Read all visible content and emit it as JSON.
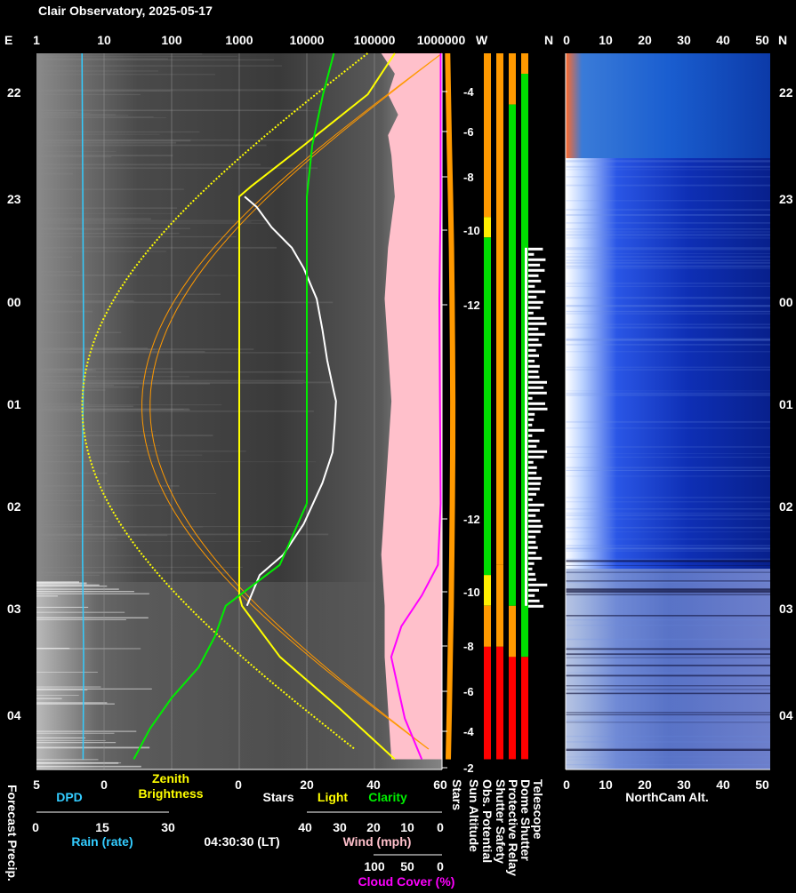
{
  "header": {
    "title": "Clair Observatory, 2025-05-17"
  },
  "colors": {
    "rain": "#33ccff",
    "zenith": "#ffff00",
    "stars": "#ffffff",
    "light": "#ffff00",
    "clarity": "#00ee00",
    "wind": "#ffc0cb",
    "cloud": "#ff00ff",
    "sun": "#ff9900",
    "green": "#00dd00",
    "orange": "#ff9900",
    "red": "#ff0000",
    "yellow": "#ffee00"
  },
  "chart_data": [
    {
      "type": "line",
      "title": "Sky panel",
      "top_axis": {
        "left_label": "E",
        "ticks": [
          "1",
          "10",
          "100",
          "1000",
          "10000",
          "100000",
          "1000000"
        ],
        "scale": "log"
      },
      "time_axis": {
        "labels": [
          "22",
          "23",
          "00",
          "01",
          "02",
          "03",
          "04"
        ],
        "hours": [
          22,
          23,
          24,
          25,
          26,
          27,
          28
        ]
      },
      "zenith_brightness": {
        "x": [
          21.6,
          22.0,
          22.5,
          22.9,
          23.0,
          23.5,
          24.0,
          24.5,
          25.0,
          25.5,
          26.0,
          26.5,
          26.9,
          27.0,
          27.5,
          28.0,
          28.5
        ],
        "y": [
          200000,
          80000,
          9000,
          1500,
          1000,
          1000,
          1000,
          1000,
          1000,
          1000,
          1000,
          1000,
          1000,
          1100,
          4000,
          30000,
          200000
        ]
      },
      "stars": {
        "x": [
          23.0,
          23.1,
          23.3,
          23.5,
          23.7,
          24.0,
          24.3,
          24.6,
          24.9,
          25.0,
          25.2,
          25.5,
          25.8,
          26.2,
          26.5,
          26.7,
          27.0
        ],
        "y": [
          1200,
          1800,
          3000,
          6000,
          9000,
          14000,
          17000,
          20000,
          25000,
          27000,
          26000,
          24000,
          17000,
          9000,
          4500,
          2000,
          1300
        ]
      },
      "clarity": {
        "x": [
          21.6,
          22.0,
          22.5,
          23.0,
          24.0,
          25.0,
          26.0,
          26.6,
          26.8,
          27.0,
          27.3,
          27.6,
          27.9,
          28.2,
          28.5
        ],
        "y": [
          40,
          38,
          36,
          35,
          35,
          35,
          35,
          30,
          25,
          20,
          18,
          15,
          10,
          6,
          3
        ]
      },
      "cloud_cover": {
        "x": [
          21.6,
          22.5,
          23.0,
          24.0,
          25.0,
          26.0,
          26.6,
          26.9,
          27.2,
          27.5,
          27.8,
          28.1,
          28.5
        ],
        "y": [
          2,
          2,
          2,
          4,
          3,
          2,
          6,
          30,
          60,
          75,
          65,
          55,
          30
        ]
      },
      "wind": {
        "x": [
          21.6,
          21.8,
          22.0,
          22.2,
          22.4,
          22.6,
          23.0,
          23.5,
          24.0,
          24.5,
          25.0,
          25.5,
          26.0,
          26.5,
          27.0,
          27.5,
          28.0,
          28.5
        ],
        "y": [
          18,
          14,
          16,
          13,
          16,
          15,
          14,
          16,
          17,
          16,
          15,
          16,
          17,
          18,
          17,
          17,
          16,
          15
        ]
      },
      "rain_rate": {
        "x": [
          21.6,
          22.5,
          23.5,
          24.5,
          25.5,
          26.5,
          27.5,
          28.5
        ],
        "y": [
          0.2,
          0.3,
          0.4,
          0.5,
          0.3,
          0.3,
          0.5,
          0.4
        ]
      }
    },
    {
      "type": "line",
      "title": "Sun Altitude",
      "right_ticks": [
        "-4",
        "-6",
        "-8",
        "-10",
        "-12",
        "-12",
        "-10",
        "-8",
        "-6",
        "-4",
        "-2"
      ],
      "x": [
        21.6,
        22.0,
        22.5,
        23.0,
        23.5,
        24.0,
        24.5,
        25.0,
        25.5,
        26.0,
        26.5,
        27.0,
        27.5,
        28.0,
        28.5
      ],
      "values": [
        -2.5,
        -3.9,
        -5.7,
        -7.8,
        -9.6,
        -10.9,
        -11.7,
        -12.1,
        -12.0,
        -11.4,
        -10.4,
        -9.1,
        -7.4,
        -5.6,
        -3.6
      ]
    },
    {
      "type": "bar",
      "title": "Status bars",
      "bars": [
        {
          "name": "Obs. Potential",
          "segments": [
            {
              "from": 21.6,
              "to": 23.2,
              "color": "orange"
            },
            {
              "from": 23.2,
              "to": 23.4,
              "color": "yellow"
            },
            {
              "from": 23.4,
              "to": 26.7,
              "color": "green"
            },
            {
              "from": 26.7,
              "to": 27.0,
              "color": "yellow"
            },
            {
              "from": 27.0,
              "to": 27.4,
              "color": "orange"
            },
            {
              "from": 27.4,
              "to": 28.5,
              "color": "red"
            }
          ]
        },
        {
          "name": "Shutter Safety",
          "segments": [
            {
              "from": 21.6,
              "to": 26.6,
              "color": "orange"
            },
            {
              "from": 26.6,
              "to": 27.4,
              "color": "orange"
            },
            {
              "from": 27.4,
              "to": 28.5,
              "color": "red"
            }
          ]
        },
        {
          "name": "Protective Relay",
          "segments": [
            {
              "from": 21.6,
              "to": 22.1,
              "color": "orange"
            },
            {
              "from": 22.1,
              "to": 27.0,
              "color": "green"
            },
            {
              "from": 27.0,
              "to": 27.5,
              "color": "orange"
            },
            {
              "from": 27.5,
              "to": 28.5,
              "color": "red"
            }
          ]
        },
        {
          "name": "Dome Shutter",
          "segments": [
            {
              "from": 21.6,
              "to": 21.8,
              "color": "orange"
            },
            {
              "from": 21.8,
              "to": 27.5,
              "color": "green"
            },
            {
              "from": 27.5,
              "to": 28.5,
              "color": "red"
            }
          ]
        }
      ],
      "telescope_activity": {
        "from": 23.5,
        "to": 27.0
      }
    },
    {
      "type": "heatmap",
      "title": "NorthCam Alt.",
      "top_ticks": [
        "W",
        "N",
        "0",
        "10",
        "20",
        "30",
        "40",
        "50",
        "N"
      ],
      "x_ticks": [
        "0",
        "10",
        "20",
        "30",
        "40",
        "50"
      ],
      "time_labels": [
        "22",
        "23",
        "00",
        "01",
        "02",
        "03",
        "04"
      ]
    }
  ],
  "footer": {
    "forecast_precip": "Forecast Precip.",
    "dpd_ticks": [
      "5",
      "0"
    ],
    "dpd_label": "DPD",
    "zenith_ticks": [
      "0"
    ],
    "zenith_label_1": "Zenith",
    "zenith_label_2": "Brightness",
    "stars_ticks": [
      "0",
      "20",
      "40",
      "60"
    ],
    "stars_label": "Stars",
    "light_label": "Light",
    "clarity_label": "Clarity",
    "rain_ticks": [
      "0",
      "15",
      "30"
    ],
    "rain_label": "Rain (rate)",
    "time_lt": "04:30:30 (LT)",
    "wind_ticks": [
      "40",
      "30",
      "20",
      "10",
      "0"
    ],
    "wind_label": "Wind (mph)",
    "cloud_ticks": [
      "100",
      "50",
      "0"
    ],
    "cloud_label": "Cloud Cover (%)",
    "vertical_labels": [
      "Stars",
      "Sun Altitude",
      "Obs. Potential",
      "Shutter Safety",
      "Protective Relay",
      "Dome Shutter",
      "Telescope"
    ],
    "northcam_ticks": [
      "0",
      "10",
      "20",
      "30",
      "40",
      "50"
    ],
    "northcam_label": "NorthCam Alt."
  }
}
